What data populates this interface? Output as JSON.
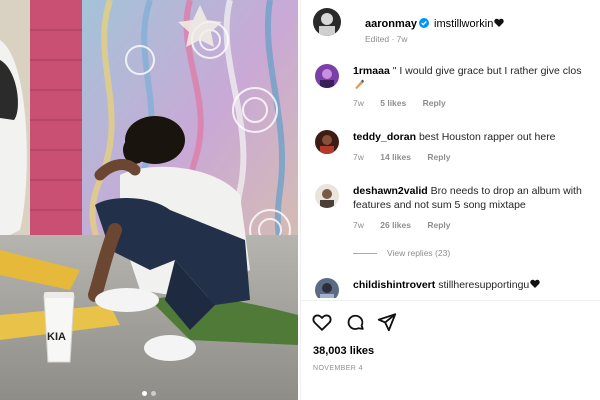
{
  "post": {
    "author": "aaronmay",
    "verified": true,
    "caption": "imstillworkin",
    "caption_emoji_icon": "black-heart-icon",
    "edited_label": "Edited",
    "time": "7w",
    "likes": "38,003 likes",
    "date": "NOVEMBER 4",
    "carousel_pages": 2
  },
  "comments": [
    {
      "username": "1rmaaa",
      "text": "\" I would give grace but I rather give clos",
      "time": "7w",
      "likes": "5 likes",
      "reply": "Reply"
    },
    {
      "username": "teddy_doran",
      "text": "best Houston rapper out here",
      "time": "7w",
      "likes": "14 likes",
      "reply": "Reply"
    },
    {
      "username": "deshawn2valid",
      "text": "Bro needs to drop an album with features and not sum 5 song mixtape",
      "time": "7w",
      "likes": "26 likes",
      "reply": "Reply",
      "view_replies": "View replies (23)"
    },
    {
      "username": "childishintrovert",
      "text": "stillheresupportingu",
      "text_emoji_icon": "black-heart-icon"
    }
  ],
  "colors": {
    "verified_blue": "#0095f6",
    "meta_gray": "#8e8e8e",
    "text": "#262626"
  },
  "icons": [
    "like-heart-icon",
    "comment-bubble-icon",
    "share-paper-plane-icon",
    "verified-badge-icon",
    "black-heart-icon"
  ]
}
